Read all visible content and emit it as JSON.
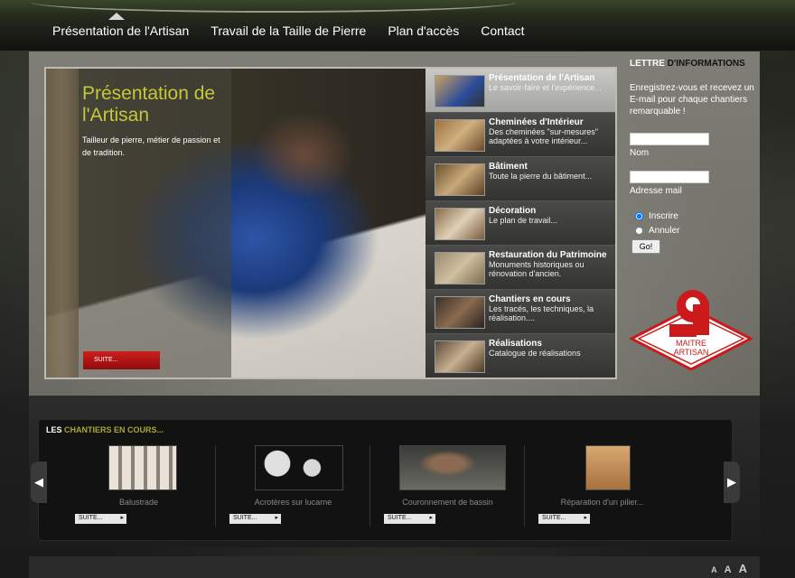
{
  "nav": {
    "items": [
      "Présentation de l'Artisan",
      "Travail de la Taille de Pierre",
      "Plan d'accès",
      "Contact"
    ]
  },
  "slide": {
    "title": "Présentation de l'Artisan",
    "description": "Tailleur de pierre, métier de passion et de tradition.",
    "button": "SUITE..."
  },
  "thumbs": [
    {
      "title": "Présentation de l'Artisan",
      "desc": "Le savoir-faire et l'expérience...",
      "active": true
    },
    {
      "title": "Cheminées d'Intérieur",
      "desc": "Des cheminées \"sur-mesures\" adaptées à votre intérieur..."
    },
    {
      "title": "Bâtiment",
      "desc": "Toute la pierre du bâtiment..."
    },
    {
      "title": "Décoration",
      "desc": "Le plan de travail..."
    },
    {
      "title": "Restauration du Patrimoine",
      "desc": "Monuments historiques ou rénovation d'ancien."
    },
    {
      "title": "Chantiers en cours",
      "desc": "Les tracés, les techniques, la réalisation...."
    },
    {
      "title": "Réalisations",
      "desc": "Catalogue de réalisations"
    }
  ],
  "newsletter": {
    "title_white": "LETTRE",
    "title_black": " D'INFORMATIONS",
    "text": "Enregistrez-vous et recevez un E-mail pour chaque chantiers remarquable !",
    "name_label": "Nom",
    "email_label": "Adresse mail",
    "radio_subscribe": "Inscrire",
    "radio_cancel": "Annuler",
    "go": "Go!"
  },
  "logo": {
    "text_line1": "MAITRE",
    "text_line2": "ARTISAN"
  },
  "chantiers": {
    "title_white": "LES",
    "title_yellow": " CHANTIERS EN COURS...",
    "items": [
      {
        "caption": "Balustrade",
        "button": "SUITE..."
      },
      {
        "caption": "Acrotères sur lucarne",
        "button": "SUITE..."
      },
      {
        "caption": "Couronnement de bassin",
        "button": "SUITE..."
      },
      {
        "caption": "Réparation d'un pilier...",
        "button": "SUITE..."
      }
    ]
  },
  "footer": {
    "font_sizes": [
      "A",
      "A",
      "A"
    ]
  }
}
